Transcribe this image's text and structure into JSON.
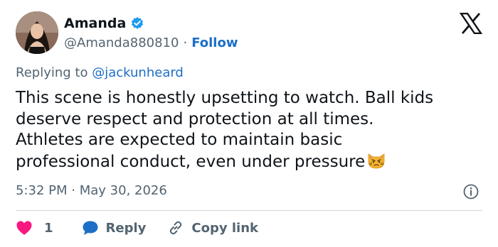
{
  "author": {
    "name": "Amanda",
    "handle": "@Amanda880810",
    "separator": "·",
    "follow_label": "Follow"
  },
  "reply_context": {
    "prefix": "Replying to",
    "mention": "@jackunheard"
  },
  "tweet": {
    "lines": [
      "This scene is honestly upsetting to watch. Ball kids",
      "deserve respect and protection at all times.",
      "Athletes are expected to maintain basic",
      "professional conduct, even under pressure"
    ],
    "emoji": "pouting-cat-face"
  },
  "meta": {
    "time": "5:32 PM",
    "separator": "·",
    "date": "May 30, 2026"
  },
  "actions": {
    "like_count": "1",
    "reply_label": "Reply",
    "copy_link_label": "Copy link"
  },
  "colors": {
    "link_blue": "#1d6ec6",
    "verified_blue": "#1d9bf0",
    "heart_pink": "#f91880",
    "muted_text": "#536471"
  },
  "icons": [
    "verified-badge-icon",
    "x-logo-icon",
    "info-icon",
    "heart-icon",
    "reply-bubble-icon",
    "link-icon"
  ]
}
